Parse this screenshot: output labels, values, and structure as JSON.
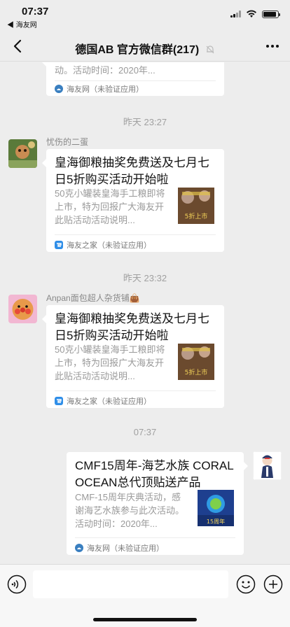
{
  "status_bar": {
    "time": "07:37",
    "back_app": "◀ 海友网",
    "battery_level": 0.9
  },
  "nav": {
    "title": "德国AB 官方微信群(217)"
  },
  "messages": [
    {
      "desc_partial": "动。活动时间：2020年...",
      "source": "海友网（未验证应用）"
    },
    {
      "timestamp": "昨天 23:27",
      "sender": "忧伤的二蛋",
      "title": "皇海御粮抽奖免费送及七月七日5折购买活动开始啦",
      "desc": "50克小罐装皇海手工粮即将上市，特为回报广大海友开此贴活动活动说明...",
      "source": "海友之家（未验证应用）",
      "thumb_text": "5折上市"
    },
    {
      "timestamp": "昨天 23:32",
      "sender": "Anpan面包超人杂货铺👜",
      "title": "皇海御粮抽奖免费送及七月七日5折购买活动开始啦",
      "desc": "50克小罐装皇海手工粮即将上市，特为回报广大海友开此贴活动活动说明...",
      "source": "海友之家（未验证应用）",
      "thumb_text": "5折上市"
    },
    {
      "timestamp": "07:37",
      "title": "CMF15周年-海艺水族 CORAL OCEAN总代顶贴送产品",
      "desc": "CMF-15周年庆典活动，感谢海艺水族参与此次活动。活动时间：2020年...",
      "source": "海友网（未验证应用）",
      "thumb_text": "15周年"
    }
  ],
  "colors": {
    "background": "#ededed",
    "bubble": "#ffffff",
    "meta_text": "#a0a0a0",
    "source_blue": "#2f8ee8"
  }
}
